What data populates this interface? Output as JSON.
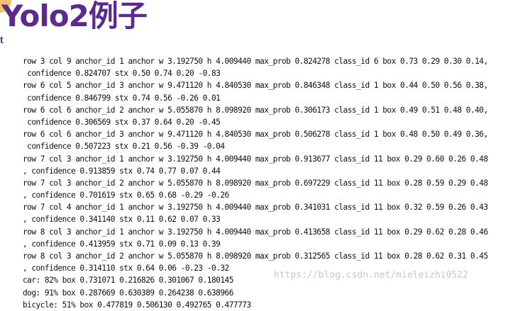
{
  "header": {
    "title": "Yolo2例子",
    "subtitle": "t"
  },
  "console": {
    "lines": [
      "row 3 col 9 anchor_id 1 anchor w 3.192750 h 4.009440 max_prob 0.824278 class_id 6 box 0.73 0.29 0.30 0.14,",
      " confidence 0.824707 stx 0.50 0.74 0.20 -0.83",
      "row 6 col 5 anchor_id 3 anchor w 9.471120 h 4.840530 max_prob 0.846348 class_id 1 box 0.44 0.50 0.56 0.38,",
      " confidence 0.846799 stx 0.74 0.56 -0.26 0.01",
      "row 6 col 6 anchor_id 2 anchor w 5.055870 h 8.098920 max_prob 0.306173 class_id 1 box 0.49 0.51 0.48 0.40,",
      " confidence 0.306569 stx 0.37 0.64 0.20 -0.45",
      "row 6 col 6 anchor_id 3 anchor w 9.471120 h 4.840530 max_prob 0.506278 class_id 1 box 0.48 0.50 0.49 0.36,",
      " confidence 0.507223 stx 0.21 0.56 -0.39 -0.04",
      "row 7 col 3 anchor_id 1 anchor w 3.192750 h 4.009440 max_prob 0.913677 class_id 11 box 0.29 0.60 0.26 0.48",
      ", confidence 0.913859 stx 0.74 0.77 0.07 0.44",
      "row 7 col 3 anchor_id 2 anchor w 5.055870 h 8.098920 max_prob 0.697229 class_id 11 box 0.28 0.59 0.29 0.48",
      ", confidence 0.701619 stx 0.65 0.68 -0.29 -0.26",
      "row 7 col 4 anchor_id 1 anchor w 3.192750 h 4.009440 max_prob 0.341031 class_id 11 box 0.32 0.59 0.26 0.43",
      ", confidence 0.341140 stx 0.11 0.62 0.07 0.33",
      "row 8 col 3 anchor_id 1 anchor w 3.192750 h 4.009440 max_prob 0.413658 class_id 11 box 0.29 0.62 0.28 0.46",
      ", confidence 0.413959 stx 0.71 0.09 0.13 0.39",
      "row 8 col 3 anchor_id 2 anchor w 5.055870 h 8.098920 max_prob 0.312565 class_id 11 box 0.28 0.62 0.31 0.45",
      ", confidence 0.314110 stx 0.64 0.06 -0.23 -0.32",
      "car: 82% box 0.731071 0.216826 0.301067 0.180145",
      "dog: 91% box 0.287669 0.630389 0.264238 0.638966",
      "bicycle: 51% box 0.477819 0.506130 0.492765 0.477773"
    ]
  },
  "watermark": "https://blog.csdn.net/mieleizhi0522",
  "colors": {
    "title": "#5c2a8c",
    "accent_circle": "#f3c26a",
    "text": "#111111",
    "watermark": "#c8c8c8"
  }
}
